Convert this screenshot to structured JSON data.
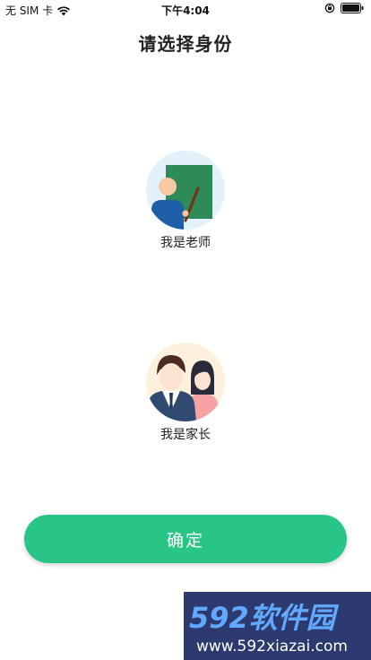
{
  "status_bar": {
    "carrier": "无 SIM 卡",
    "time": "下午4:04",
    "icons": [
      "wifi-icon",
      "rotation-lock-icon",
      "battery-icon"
    ]
  },
  "header": {
    "title": "请选择身份"
  },
  "roles": [
    {
      "label": "我是老师",
      "icon": "teacher-icon"
    },
    {
      "label": "我是家长",
      "icon": "parent-icon"
    }
  ],
  "confirm": {
    "label": "确定"
  },
  "watermark": {
    "brand": "592软件园",
    "url": "www.592xiazai.com"
  },
  "colors": {
    "accent": "#29c587",
    "teacher_bg": "#e3f1fb",
    "parent_bg": "#fdf1de",
    "watermark_bg": "#2c3a70"
  }
}
